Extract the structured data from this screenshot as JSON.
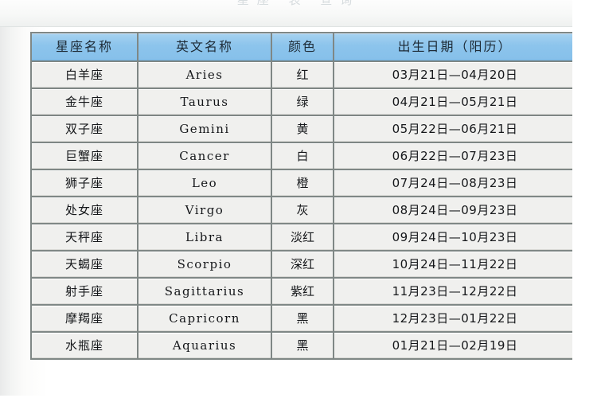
{
  "page": {
    "top_title_faint": "星座  表  查询"
  },
  "table": {
    "columns": [
      {
        "key": "cn_name",
        "label": "星座名称"
      },
      {
        "key": "en_name",
        "label": "英文名称"
      },
      {
        "key": "color",
        "label": "颜色"
      },
      {
        "key": "date",
        "label": "出生日期（阳历）"
      }
    ],
    "header_bg": "#8CC4EC",
    "cell_bg": "#F0F0EE",
    "grid_color": "#7F8785",
    "rows": [
      {
        "cn_name": "白羊座",
        "en_name": "Aries",
        "color": "红",
        "date": "03月21日—04月20日"
      },
      {
        "cn_name": "金牛座",
        "en_name": "Taurus",
        "color": "绿",
        "date": "04月21日—05月21日"
      },
      {
        "cn_name": "双子座",
        "en_name": "Gemini",
        "color": "黄",
        "date": "05月22日—06月21日"
      },
      {
        "cn_name": "巨蟹座",
        "en_name": "Cancer",
        "color": "白",
        "date": "06月22日—07月23日"
      },
      {
        "cn_name": "狮子座",
        "en_name": "Leo",
        "color": "橙",
        "date": "07月24日—08月23日"
      },
      {
        "cn_name": "处女座",
        "en_name": "Virgo",
        "color": "灰",
        "date": "08月24日—09月23日"
      },
      {
        "cn_name": "天秤座",
        "en_name": "Libra",
        "color": "淡红",
        "date": "09月24日—10月23日"
      },
      {
        "cn_name": "天蝎座",
        "en_name": "Scorpio",
        "color": "深红",
        "date": "10月24日—11月22日"
      },
      {
        "cn_name": "射手座",
        "en_name": "Sagittarius",
        "color": "紫红",
        "date": "11月23日—12月22日"
      },
      {
        "cn_name": "摩羯座",
        "en_name": "Capricorn",
        "color": "黑",
        "date": "12月23日—01月22日"
      },
      {
        "cn_name": "水瓶座",
        "en_name": "Aquarius",
        "color": "黑",
        "date": "01月21日—02月19日"
      }
    ]
  }
}
